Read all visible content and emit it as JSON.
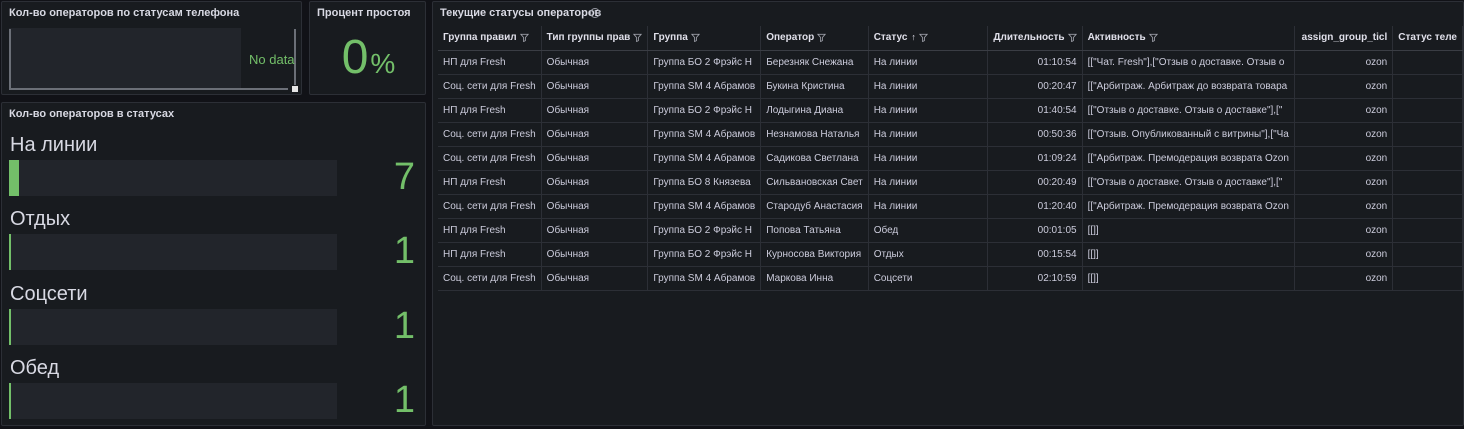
{
  "panels": {
    "phone_status": {
      "title": "Кол-во операторов по статусам телефона",
      "no_data": "No data"
    },
    "idle_percent": {
      "title": "Процент простоя",
      "value": "0",
      "unit": "%"
    },
    "status_counts": {
      "title": "Кол-во операторов в статусах",
      "items": [
        {
          "label": "На линии",
          "value": "7",
          "fill": 0.03
        },
        {
          "label": "Отдых",
          "value": "1",
          "fill": 0.004
        },
        {
          "label": "Соцсети",
          "value": "1",
          "fill": 0.004
        },
        {
          "label": "Обед",
          "value": "1",
          "fill": 0.004
        }
      ]
    },
    "current_statuses": {
      "title": "Текущие статусы операторов",
      "columns": [
        "Группа правил",
        "Тип группы прав",
        "Группа",
        "Оператор",
        "Статус",
        "Длительность",
        "Активность",
        "assign_group_ticl",
        "Статус теле"
      ],
      "rows": [
        [
          "НП для Fresh",
          "Обычная",
          "Группа БО 2 Фрэйс Н",
          "Березняк Снежана",
          "На линии",
          "01:10:54",
          "[[\"Чат. Fresh\"],[\"Отзыв о доставке. Отзыв о",
          "ozon",
          ""
        ],
        [
          "Соц. сети для Fresh",
          "Обычная",
          "Группа SM 4 Абрамов",
          "Букина Кристина",
          "На линии",
          "00:20:47",
          "[[\"Арбитраж. Арбитраж до возврата товара",
          "ozon",
          ""
        ],
        [
          "НП для Fresh",
          "Обычная",
          "Группа БО 2 Фрэйс Н",
          "Лодыгина Диана",
          "На линии",
          "01:40:54",
          "[[\"Отзыв о доставке. Отзыв о доставке\"],[\"",
          "ozon",
          ""
        ],
        [
          "Соц. сети для Fresh",
          "Обычная",
          "Группа SM 4 Абрамов",
          "Незнамова Наталья",
          "На линии",
          "00:50:36",
          "[[\"Отзыв. Опубликованный с витрины\"],[\"Ча",
          "ozon",
          ""
        ],
        [
          "Соц. сети для Fresh",
          "Обычная",
          "Группа SM 4 Абрамов",
          "Садикова Светлана",
          "На линии",
          "01:09:24",
          "[[\"Арбитраж. Премодерация возврата Ozon",
          "ozon",
          ""
        ],
        [
          "НП для Fresh",
          "Обычная",
          "Группа БО 8 Князева",
          "Сильвановская Свет",
          "На линии",
          "00:20:49",
          "[[\"Отзыв о доставке. Отзыв о доставке\"],[\"",
          "ozon",
          ""
        ],
        [
          "Соц. сети для Fresh",
          "Обычная",
          "Группа SM 4 Абрамов",
          "Стародуб Анастасия",
          "На линии",
          "01:20:40",
          "[[\"Арбитраж. Премодерация возврата Ozon",
          "ozon",
          ""
        ],
        [
          "НП для Fresh",
          "Обычная",
          "Группа БО 2 Фрэйс Н",
          "Попова Татьяна",
          "Обед",
          "00:01:05",
          "[[]]",
          "ozon",
          ""
        ],
        [
          "НП для Fresh",
          "Обычная",
          "Группа БО 2 Фрэйс Н",
          "Курносова Виктория",
          "Отдых",
          "00:15:54",
          "[[]]",
          "ozon",
          ""
        ],
        [
          "Соц. сети для Fresh",
          "Обычная",
          "Группа SM 4 Абрамов",
          "Маркова Инна",
          "Соцсети",
          "02:10:59",
          "[[]]",
          "ozon",
          ""
        ]
      ]
    }
  },
  "colors": {
    "accent_green": "#73bf69",
    "panel_bg": "#181b1f",
    "page_bg": "#111217"
  }
}
